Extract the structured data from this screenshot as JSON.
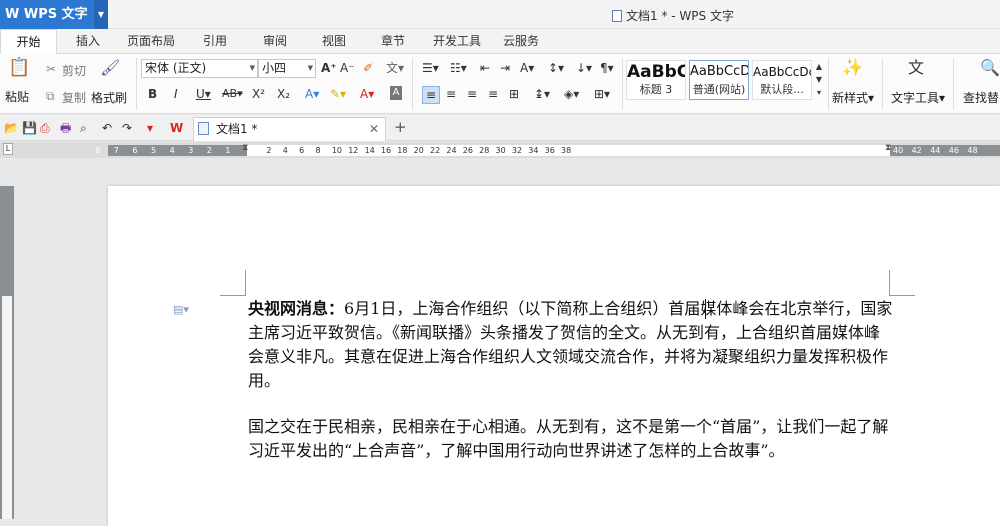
{
  "app": {
    "name": "WPS 文字",
    "window_title": "文档1 * - WPS 文字"
  },
  "tabs": [
    "开始",
    "插入",
    "页面布局",
    "引用",
    "审阅",
    "视图",
    "章节",
    "开发工具",
    "云服务"
  ],
  "ribbon": {
    "paste": "粘贴",
    "cut": "剪切",
    "copy": "复制",
    "format_painter": "格式刷",
    "font_name": "宋体 (正文)",
    "font_size": "小四",
    "styles": [
      {
        "preview": "AaBbC",
        "name": "标题 3"
      },
      {
        "preview": "AaBbCcD",
        "name": "普通(网站)"
      },
      {
        "preview": "AaBbCcDc",
        "name": "默认段..."
      }
    ],
    "new_style": "新样式",
    "text_tools": "文字工具",
    "find_replace": "查找替"
  },
  "doc_tab": {
    "title": "文档1 *"
  },
  "ruler": {
    "left_numbers": [
      "8",
      "7",
      "6",
      "5",
      "4",
      "3",
      "2",
      "1"
    ],
    "right_numbers": [
      "2",
      "4",
      "6",
      "8",
      "10",
      "12",
      "14",
      "16",
      "18",
      "20",
      "22",
      "24",
      "26",
      "28",
      "30",
      "32",
      "34",
      "36",
      "38"
    ],
    "far_right_numbers": [
      "40",
      "42",
      "44",
      "46",
      "48"
    ]
  },
  "document": {
    "p1_bold": "央视网消息：",
    "p1_rest": "6月1日，上海合作组织（以下简称上合组织）首届媒体峰会在北京举行，国家主席习近平致贺信。《新闻联播》头条播发了贺信的全文。从无到有，上合组织首届媒体峰会意义非凡。其意在促进上海合作组织人文领域交流合作，并将为凝聚组织力量发挥积极作用。",
    "p2": "国之交在于民相亲，民相亲在于心相通。从无到有，这不是第一个“首届”，让我们一起了解习近平发出的“上合声音”，了解中国用行动向世界讲述了怎样的上合故事”。"
  }
}
